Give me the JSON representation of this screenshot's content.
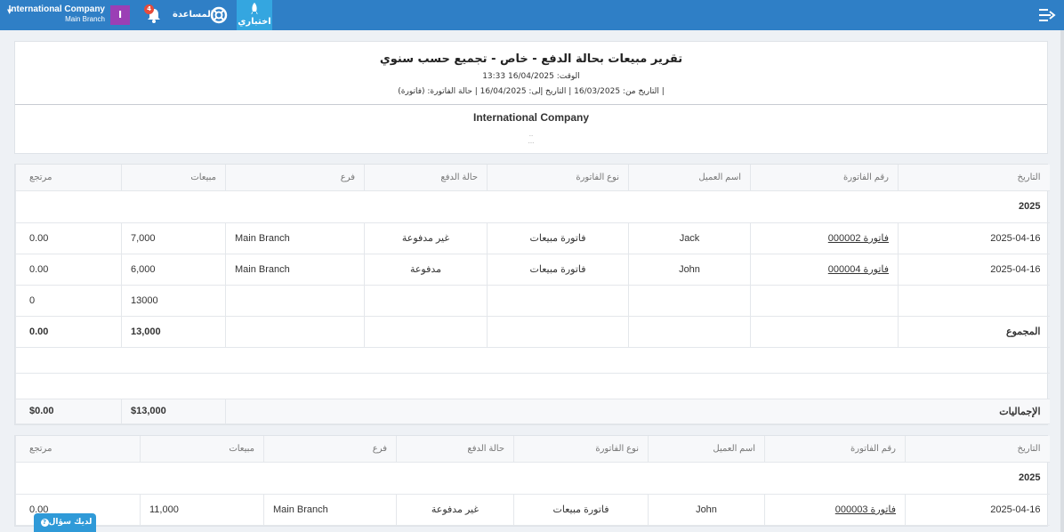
{
  "topbar": {
    "company_name": "International Company",
    "branch": "Main Branch",
    "avatar_letter": "I",
    "notification_count": "4",
    "help_label": "المساعدة",
    "trial_label": "اختباري"
  },
  "report": {
    "title": "تقرير مبيعات بحالة الدفع - خاص - تجميع حسب سنوي",
    "time": "الوقت: 16/04/2025 13:33",
    "filters": "التاريخ من: 16/03/2025 | التاريخ إلى: 16/04/2025 | حالة الفاتورة: (فاتورة) |",
    "company": "International Company",
    "dots1": "..",
    "dots2": "..."
  },
  "table1": {
    "headers": [
      "التاريخ",
      "رقم الفاتورة",
      "اسم العميل",
      "نوع الفاتورة",
      "حالة الدفع",
      "فرع",
      "مبيعات",
      "مرتجع"
    ],
    "year": "2025",
    "rows": [
      {
        "date": "2025-04-16",
        "invoice": "فاتورة 000002",
        "customer": "Jack",
        "type": "فاتورة مبيعات",
        "status": "غير مدفوعة",
        "branch": "Main Branch",
        "sales": "7,000",
        "returns": "0.00"
      },
      {
        "date": "2025-04-16",
        "invoice": "فاتورة 000004",
        "customer": "John",
        "type": "فاتورة مبيعات",
        "status": "مدفوعة",
        "branch": "Main Branch",
        "sales": "6,000",
        "returns": "0.00"
      }
    ],
    "subtotal": {
      "sales": "13000",
      "returns": "0"
    },
    "total": {
      "label": "المجموع",
      "sales": "13,000",
      "returns": "0.00"
    },
    "grand": {
      "label": "الإجماليات",
      "sales": "$13,000",
      "returns": "$0.00"
    }
  },
  "table2": {
    "headers": [
      "التاريخ",
      "رقم الفاتورة",
      "اسم العميل",
      "نوع الفاتورة",
      "حالة الدفع",
      "فرع",
      "مبيعات",
      "مرتجع"
    ],
    "year": "2025",
    "rows": [
      {
        "date": "2025-04-16",
        "invoice": "فاتورة 000003",
        "customer": "John",
        "type": "فاتورة مبيعات",
        "status": "غير مدفوعة",
        "branch": "Main Branch",
        "sales": "11,000",
        "returns": "0.00"
      }
    ]
  },
  "ask_label": "لديك سؤال"
}
